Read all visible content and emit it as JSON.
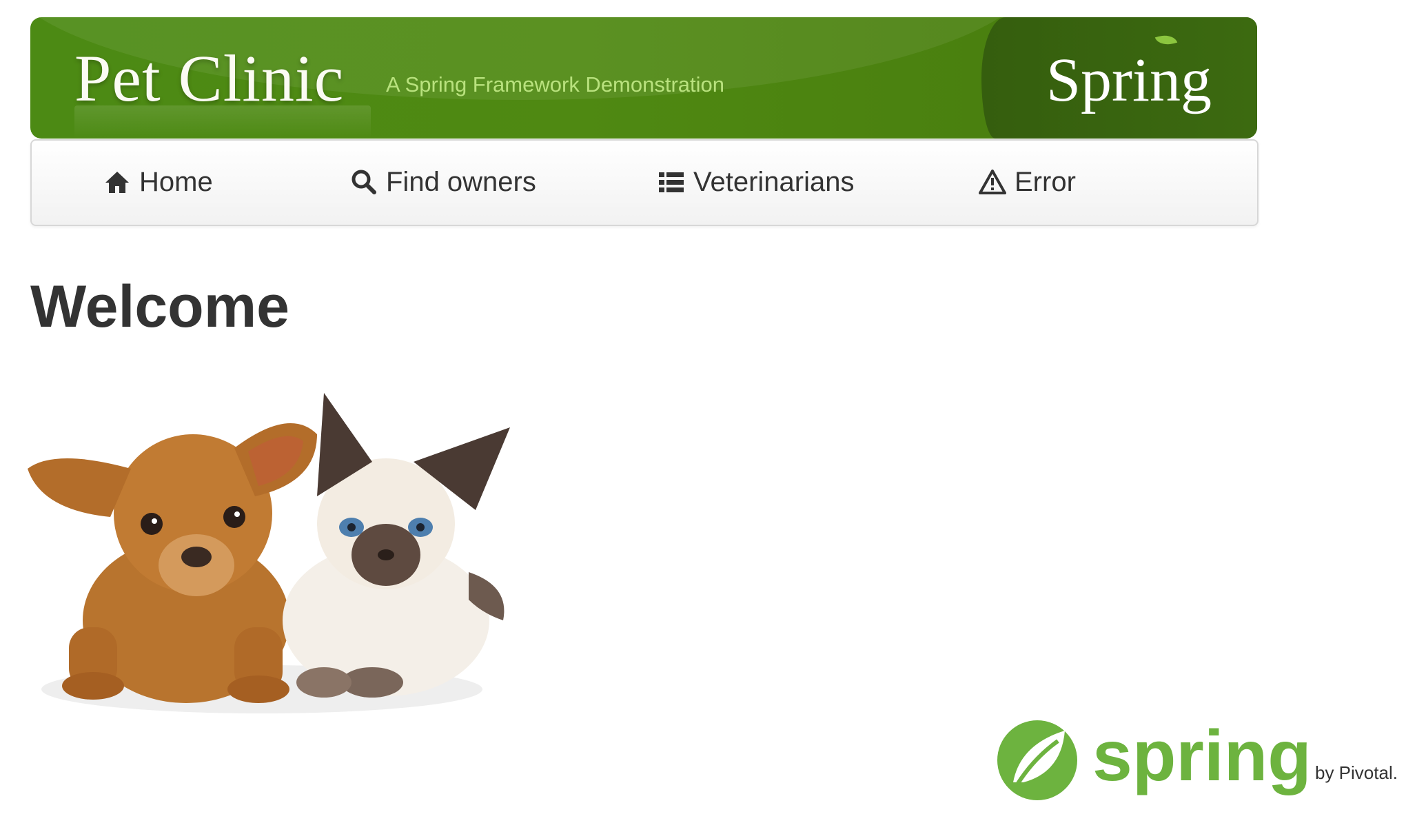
{
  "header": {
    "brand_title": "Pet Clinic",
    "brand_subtitle": "A Spring Framework Demonstration",
    "spring_logo_text": "Spring",
    "colors": {
      "banner_green": "#4c8a14",
      "banner_dark_green": "#355e0e",
      "subtitle_green": "#b9e27e"
    }
  },
  "nav": {
    "items": [
      {
        "label": "Home",
        "icon": "home-icon"
      },
      {
        "label": "Find owners",
        "icon": "search-icon"
      },
      {
        "label": "Veterinarians",
        "icon": "list-icon"
      },
      {
        "label": "Error",
        "icon": "warning-icon"
      }
    ]
  },
  "main": {
    "title": "Welcome",
    "image": "pets-image"
  },
  "footer": {
    "logo_text": "spring",
    "logo_byline": "by Pivotal.",
    "logo_color": "#6db33f"
  }
}
